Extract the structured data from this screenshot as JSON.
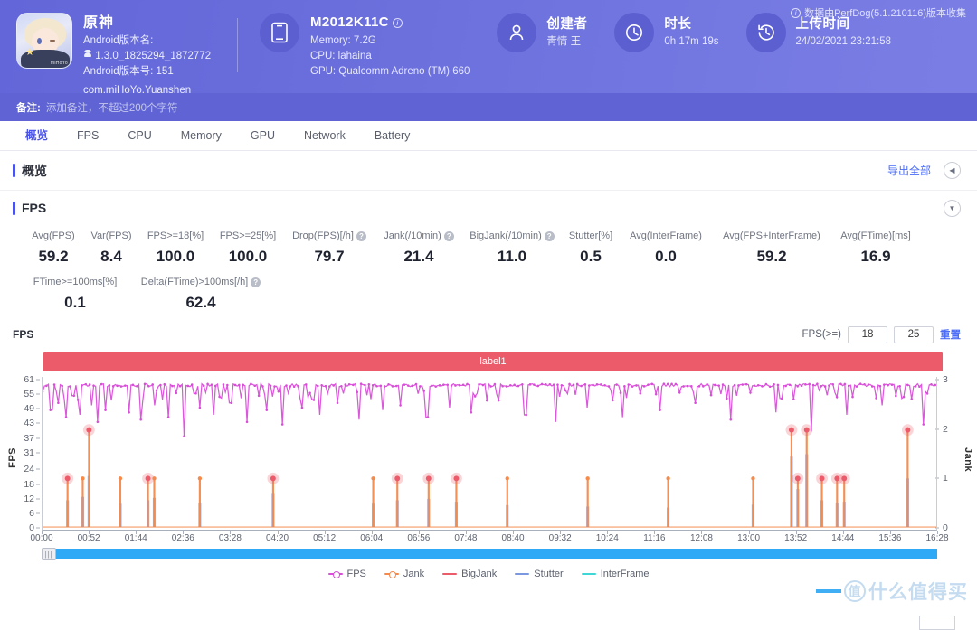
{
  "header": {
    "app": {
      "name": "原神",
      "android_version_label": "Android版本名:",
      "android_version": "1.3.0_1825294_1872772",
      "android_build_label": "Android版本号: 151",
      "package": "com.miHoYo.Yuanshen",
      "icon": "genshin-app-icon",
      "icon_watermark": "miHoYo"
    },
    "device": {
      "model": "M2012K11C",
      "memory": "Memory: 7.2G",
      "cpu": "CPU: lahaina",
      "gpu": "GPU: Qualcomm Adreno (TM) 660",
      "icon": "phone-icon",
      "info_icon": "info-icon"
    },
    "creator": {
      "title": "创建者",
      "value": "靑情 王",
      "icon": "user-icon"
    },
    "duration": {
      "title": "时长",
      "value": "0h 17m 19s",
      "icon": "clock-icon"
    },
    "upload": {
      "title": "上传时间",
      "value": "24/02/2021 23:21:58",
      "icon": "history-icon"
    },
    "perfdog_note": "数据由PerfDog(5.1.210116)版本收集",
    "perfdog_note_icon": "info-icon",
    "note_label": "备注:",
    "note_placeholder": "添加备注，不超过200个字符",
    "accent": "#6266d8"
  },
  "tabs": [
    {
      "label": "概览",
      "active": true
    },
    {
      "label": "FPS",
      "active": false
    },
    {
      "label": "CPU",
      "active": false
    },
    {
      "label": "Memory",
      "active": false
    },
    {
      "label": "GPU",
      "active": false
    },
    {
      "label": "Network",
      "active": false
    },
    {
      "label": "Battery",
      "active": false
    }
  ],
  "overview": {
    "title": "概览",
    "export_all": "导出全部",
    "collapse_icon": "chevron-left-icon"
  },
  "fps_section": {
    "title": "FPS",
    "expand_icon": "chevron-down-icon",
    "metrics_row1": [
      {
        "label": "Avg(FPS)",
        "value": "59.2",
        "help": false
      },
      {
        "label": "Var(FPS)",
        "value": "8.4",
        "help": false
      },
      {
        "label": "FPS>=18[%]",
        "value": "100.0",
        "help": false
      },
      {
        "label": "FPS>=25[%]",
        "value": "100.0",
        "help": false
      },
      {
        "label": "Drop(FPS)[/h]",
        "value": "79.7",
        "help": true
      },
      {
        "label": "Jank(/10min)",
        "value": "21.4",
        "help": true
      },
      {
        "label": "BigJank(/10min)",
        "value": "11.0",
        "help": true
      },
      {
        "label": "Stutter[%]",
        "value": "0.5",
        "help": false
      },
      {
        "label": "Avg(InterFrame)",
        "value": "0.0",
        "help": false
      },
      {
        "label": "Avg(FPS+InterFrame)",
        "value": "59.2",
        "help": false
      },
      {
        "label": "Avg(FTime)[ms]",
        "value": "16.9",
        "help": false
      }
    ],
    "metrics_row2": [
      {
        "label": "FTime>=100ms[%]",
        "value": "0.1",
        "help": false
      },
      {
        "label": "Delta(FTime)>100ms[/h]",
        "value": "62.4",
        "help": true
      }
    ]
  },
  "chart_controls": {
    "chart_name": "FPS",
    "fps_ge_label": "FPS(>=)",
    "threshold_low": "18",
    "threshold_high": "25",
    "reset_label": "重置",
    "band_label": "label1",
    "band_color": "#ec5b6a"
  },
  "chart_data": {
    "type": "line",
    "title": "FPS",
    "xlabel": "",
    "ylabel": "FPS",
    "y2label": "Jank",
    "ylim": [
      0,
      61
    ],
    "y2lim": [
      0,
      3
    ],
    "grid": false,
    "legend_position": "bottom",
    "yticks": [
      0,
      6,
      12,
      18,
      24,
      31,
      37,
      43,
      49,
      55,
      61
    ],
    "y2ticks": [
      0,
      1,
      2,
      3
    ],
    "xticks": [
      "00:00",
      "00:52",
      "01:44",
      "02:36",
      "03:28",
      "04:20",
      "05:12",
      "06:04",
      "06:56",
      "07:48",
      "08:40",
      "09:32",
      "10:24",
      "11:16",
      "12:08",
      "13:00",
      "13:52",
      "14:44",
      "15:36",
      "16:28"
    ],
    "series": [
      {
        "name": "FPS",
        "color": "#d94ed9",
        "axis": "left",
        "marker": "dot-line"
      },
      {
        "name": "Jank",
        "color": "#f58a4b",
        "axis": "right",
        "marker": "dot-line"
      },
      {
        "name": "BigJank",
        "color": "#ec5b6a",
        "axis": "right",
        "marker": "line"
      },
      {
        "name": "Stutter",
        "color": "#7b97e0",
        "axis": "right",
        "marker": "line"
      },
      {
        "name": "InterFrame",
        "color": "#3fd6d6",
        "axis": "left",
        "marker": "line"
      }
    ],
    "fps_baseline": 60,
    "fps_dips": [
      {
        "t": 10,
        "v": 49
      },
      {
        "t": 18,
        "v": 52
      },
      {
        "t": 26,
        "v": 46
      },
      {
        "t": 34,
        "v": 55
      },
      {
        "t": 42,
        "v": 47
      },
      {
        "t": 55,
        "v": 51
      },
      {
        "t": 62,
        "v": 44
      },
      {
        "t": 70,
        "v": 49
      },
      {
        "t": 78,
        "v": 53
      },
      {
        "t": 96,
        "v": 48
      },
      {
        "t": 110,
        "v": 45
      },
      {
        "t": 125,
        "v": 51
      },
      {
        "t": 140,
        "v": 46
      },
      {
        "t": 158,
        "v": 38
      },
      {
        "t": 175,
        "v": 50
      },
      {
        "t": 192,
        "v": 47
      },
      {
        "t": 210,
        "v": 52
      },
      {
        "t": 228,
        "v": 44
      },
      {
        "t": 250,
        "v": 49
      },
      {
        "t": 268,
        "v": 43
      },
      {
        "t": 290,
        "v": 50
      },
      {
        "t": 310,
        "v": 47
      },
      {
        "t": 330,
        "v": 52
      },
      {
        "t": 355,
        "v": 45
      },
      {
        "t": 380,
        "v": 49
      },
      {
        "t": 400,
        "v": 51
      },
      {
        "t": 430,
        "v": 46
      },
      {
        "t": 455,
        "v": 50
      },
      {
        "t": 480,
        "v": 48
      },
      {
        "t": 510,
        "v": 53
      },
      {
        "t": 540,
        "v": 47
      },
      {
        "t": 575,
        "v": 44
      },
      {
        "t": 610,
        "v": 50
      },
      {
        "t": 650,
        "v": 46
      },
      {
        "t": 690,
        "v": 49
      },
      {
        "t": 730,
        "v": 52
      },
      {
        "t": 770,
        "v": 45
      },
      {
        "t": 820,
        "v": 48
      },
      {
        "t": 860,
        "v": 40
      },
      {
        "t": 900,
        "v": 47
      },
      {
        "t": 940,
        "v": 51
      },
      {
        "t": 985,
        "v": 43
      }
    ],
    "jank_events": [
      {
        "t": 28,
        "jank": 1,
        "big": true,
        "stutter": 0.55
      },
      {
        "t": 45,
        "jank": 1,
        "big": false,
        "stutter": 0.62
      },
      {
        "t": 52,
        "jank": 2,
        "big": true,
        "stutter": 1.05
      },
      {
        "t": 87,
        "jank": 1,
        "big": false,
        "stutter": 0.48
      },
      {
        "t": 118,
        "jank": 1,
        "big": true,
        "stutter": 0.55
      },
      {
        "t": 125,
        "jank": 1,
        "big": false,
        "stutter": 0.6
      },
      {
        "t": 176,
        "jank": 1,
        "big": false,
        "stutter": 0.5
      },
      {
        "t": 258,
        "jank": 1,
        "big": true,
        "stutter": 0.7
      },
      {
        "t": 370,
        "jank": 1,
        "big": false,
        "stutter": 0.48
      },
      {
        "t": 397,
        "jank": 1,
        "big": true,
        "stutter": 0.55
      },
      {
        "t": 432,
        "jank": 1,
        "big": true,
        "stutter": 0.58
      },
      {
        "t": 463,
        "jank": 1,
        "big": true,
        "stutter": 0.52
      },
      {
        "t": 520,
        "jank": 1,
        "big": false,
        "stutter": 0.45
      },
      {
        "t": 610,
        "jank": 1,
        "big": false,
        "stutter": 0.42
      },
      {
        "t": 700,
        "jank": 1,
        "big": false,
        "stutter": 0.4
      },
      {
        "t": 795,
        "jank": 1,
        "big": false,
        "stutter": 0.46
      },
      {
        "t": 838,
        "jank": 2,
        "big": true,
        "stutter": 1.45
      },
      {
        "t": 845,
        "jank": 1,
        "big": true,
        "stutter": 0.78
      },
      {
        "t": 855,
        "jank": 2,
        "big": true,
        "stutter": 1.5
      },
      {
        "t": 872,
        "jank": 1,
        "big": true,
        "stutter": 0.55
      },
      {
        "t": 889,
        "jank": 1,
        "big": true,
        "stutter": 0.5
      },
      {
        "t": 897,
        "jank": 1,
        "big": true,
        "stutter": 0.52
      },
      {
        "t": 968,
        "jank": 2,
        "big": true,
        "stutter": 1.0
      }
    ],
    "legend": [
      "FPS",
      "Jank",
      "BigJank",
      "Stutter",
      "InterFrame"
    ]
  },
  "scrollbar": {
    "handle_icon": "drag-handle-icon"
  },
  "watermark": {
    "text": "什么值得买",
    "mark": "值"
  }
}
